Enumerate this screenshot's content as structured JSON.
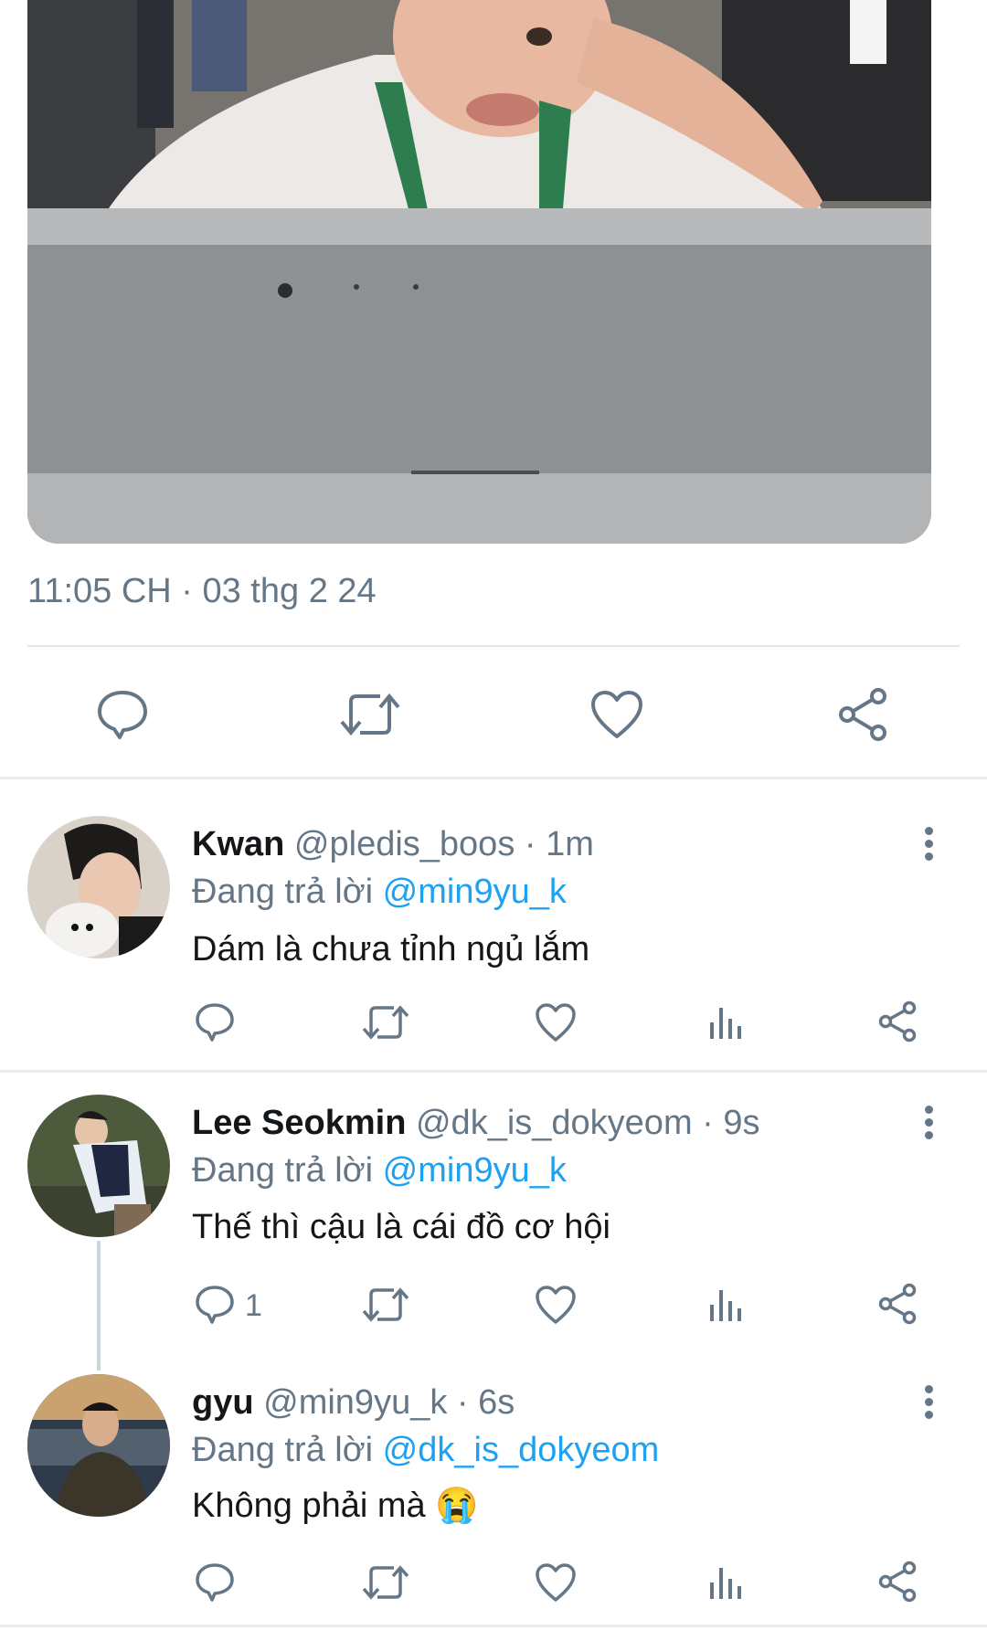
{
  "tweet": {
    "timestamp": "11:05 CH · 03 thg 2 24",
    "media_icon": "photo-child-at-laptop"
  },
  "main_actions": {
    "reply_icon": "reply-icon",
    "retweet_icon": "retweet-icon",
    "like_icon": "heart-icon",
    "share_icon": "share-icon"
  },
  "replies": [
    {
      "name": "Kwan",
      "handle": "@pledis_boos",
      "time": "· 1m",
      "replying_label": "Đang trả lời",
      "replying_to": "@min9yu_k",
      "text": "Dám là chưa tỉnh ngủ lắm",
      "reply_count": ""
    },
    {
      "name": "Lee Seokmin",
      "handle": "@dk_is_dokyeom",
      "time": "· 9s",
      "replying_label": "Đang trả lời",
      "replying_to": "@min9yu_k",
      "text": "Thế thì cậu là cái đồ cơ hội",
      "reply_count": "1"
    },
    {
      "name": "gyu",
      "handle": "@min9yu_k",
      "time": "· 6s",
      "replying_label": "Đang trả lời",
      "replying_to": "@dk_is_dokyeom",
      "text": "Không phải mà 😭",
      "reply_count": ""
    }
  ],
  "colors": {
    "accent": "#1da1f2",
    "secondary_text": "#657786",
    "icon": "#657786"
  }
}
